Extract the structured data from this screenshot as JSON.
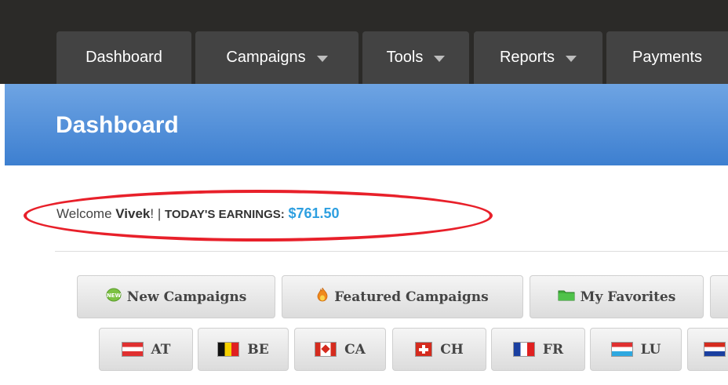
{
  "nav": {
    "tabs": [
      {
        "label": "Dashboard"
      },
      {
        "label": "Campaigns"
      },
      {
        "label": "Tools"
      },
      {
        "label": "Reports"
      },
      {
        "label": "Payments"
      }
    ]
  },
  "header": {
    "title": "Dashboard"
  },
  "welcome": {
    "prefix": "Welcome ",
    "name": "Vivek",
    "suffix": "! | ",
    "earnings_label": "TODAY'S EARNINGS:",
    "earnings_value": "$761.50"
  },
  "filters": {
    "buttons": [
      {
        "label": "New Campaigns",
        "icon": "new-badge-icon"
      },
      {
        "label": "Featured Campaigns",
        "icon": "flame-icon"
      },
      {
        "label": "My Favorites",
        "icon": "folder-icon"
      }
    ]
  },
  "countries": [
    {
      "code": "AT"
    },
    {
      "code": "BE"
    },
    {
      "code": "CA"
    },
    {
      "code": "CH"
    },
    {
      "code": "FR"
    },
    {
      "code": "LU"
    }
  ],
  "colors": {
    "accent_blue": "#3d7fd0",
    "earnings_blue": "#2d9fe0",
    "highlight_red": "#e8202a",
    "nav_bg": "#2b2a28",
    "tab_bg": "#434343"
  }
}
